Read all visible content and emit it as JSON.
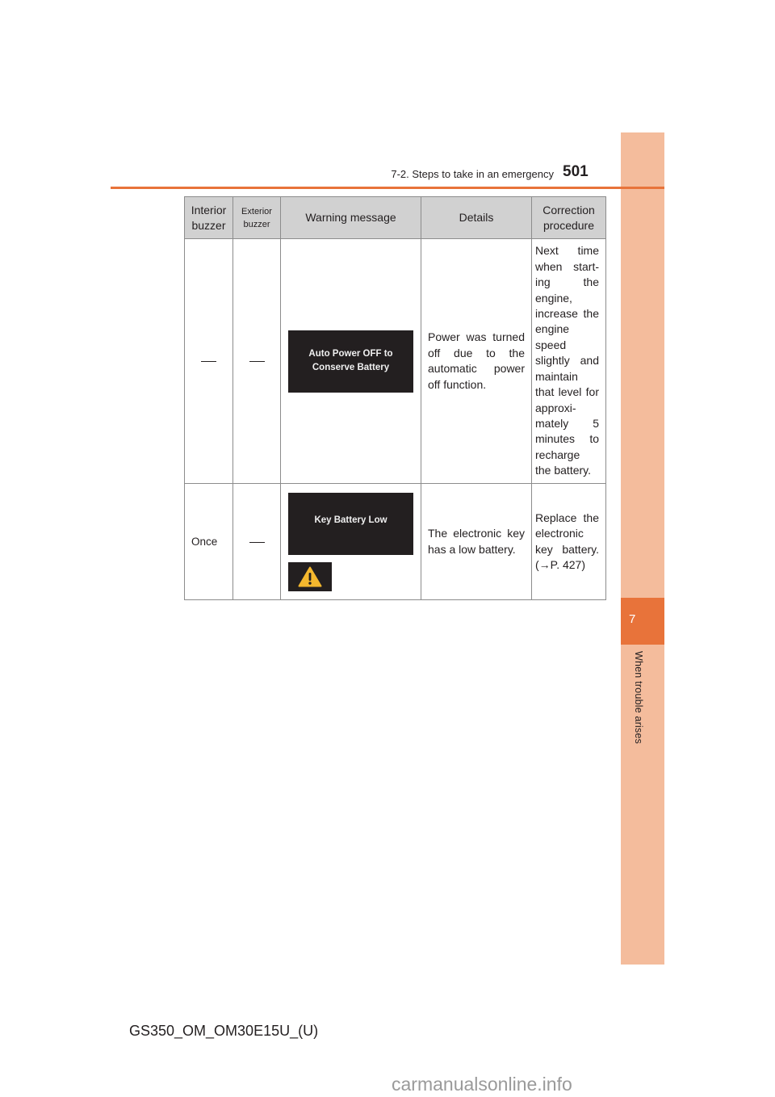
{
  "header": {
    "section_title": "7-2. Steps to take in an emergency",
    "page_number": "501"
  },
  "side_tab": {
    "chapter_number": "7",
    "chapter_label": "When trouble arises"
  },
  "table": {
    "headers": [
      "Interior buzzer",
      "Exterior buzzer",
      "Warning message",
      "Details",
      "Correction procedure"
    ],
    "rows": [
      {
        "interior_buzzer": "—",
        "exterior_buzzer": "—",
        "warning_message": [
          "Auto Power OFF to",
          "Conserve Battery"
        ],
        "details": "Power was turned off due to the automatic power off function.",
        "correction_lines": [
          "Next time",
          "when start-",
          "ing the",
          "engine,",
          "increase the",
          "engine",
          "speed",
          "slightly and",
          "maintain",
          "that level for",
          "approxi-",
          "mately 5",
          "minutes to",
          "recharge",
          "the battery."
        ]
      },
      {
        "interior_buzzer": "Once",
        "exterior_buzzer": "—",
        "warning_message": [
          "Key Battery Low"
        ],
        "warning_icon": "warning-triangle-icon",
        "details": "The electronic key has a low battery.",
        "correction_lines": [
          "Replace the",
          "electronic",
          "key battery.",
          "(→P. 427)"
        ]
      }
    ]
  },
  "colors": {
    "accent_orange": "#e8733a",
    "side_strip": "#f4bc9c",
    "header_bg": "#d1d1d1",
    "warning_yellow": "#f5b82e"
  },
  "footer": {
    "doc_code": "GS350_OM_OM30E15U_(U)",
    "watermark": "carmanualsonline.info"
  }
}
